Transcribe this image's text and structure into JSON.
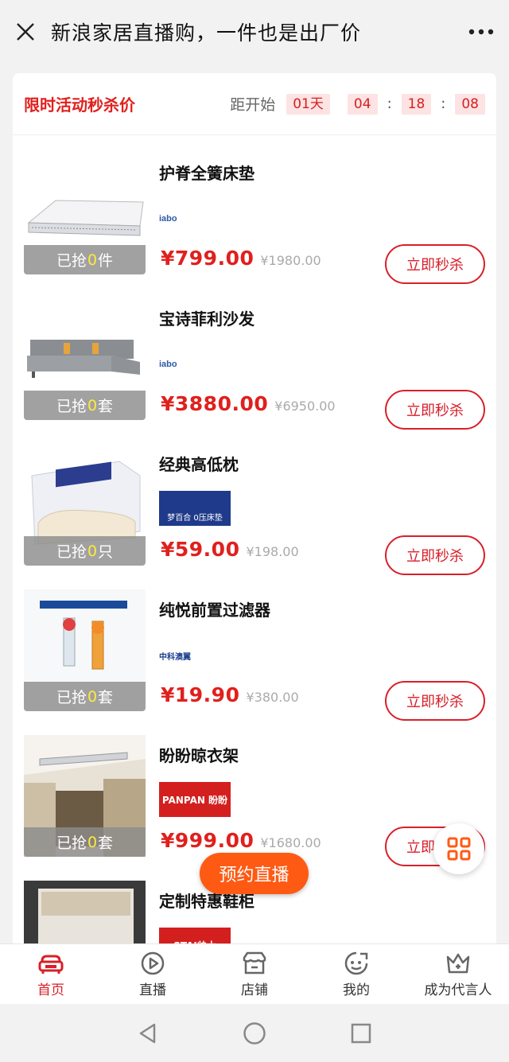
{
  "header": {
    "title": "新浪家居直播购，一件也是出厂价"
  },
  "flash": {
    "title": "限时活动秒杀价",
    "countdown_label": "距开始",
    "days": "01天",
    "hours": "04",
    "minutes": "18",
    "seconds": "08",
    "separator": ":"
  },
  "products": [
    {
      "name": "护脊全簧床垫",
      "price": "¥799.00",
      "original_price": "¥1980.00",
      "sold_prefix": "已抢",
      "sold_count": "0",
      "sold_unit": "件",
      "button": "立即秒杀",
      "brand": "iabo"
    },
    {
      "name": "宝诗菲利沙发",
      "price": "¥3880.00",
      "original_price": "¥6950.00",
      "sold_prefix": "已抢",
      "sold_count": "0",
      "sold_unit": "套",
      "button": "立即秒杀",
      "brand": "iabo"
    },
    {
      "name": "经典高低枕",
      "price": "¥59.00",
      "original_price": "¥198.00",
      "sold_prefix": "已抢",
      "sold_count": "0",
      "sold_unit": "只",
      "button": "立即秒杀",
      "brand": "梦百合 0压床垫"
    },
    {
      "name": "纯悦前置过滤器",
      "price": "¥19.90",
      "original_price": "¥380.00",
      "sold_prefix": "已抢",
      "sold_count": "0",
      "sold_unit": "套",
      "button": "立即秒杀",
      "brand": "中科澳翼"
    },
    {
      "name": "盼盼晾衣架",
      "price": "¥999.00",
      "original_price": "¥1680.00",
      "sold_prefix": "已抢",
      "sold_count": "0",
      "sold_unit": "套",
      "button": "立即秒杀",
      "brand": "PANPAN 盼盼"
    },
    {
      "name": "定制特惠鞋柜",
      "brand": "STAI帅太"
    }
  ],
  "floating": {
    "live_label": "预约直播"
  },
  "tabs": [
    {
      "label": "首页",
      "icon": "sofa-icon"
    },
    {
      "label": "直播",
      "icon": "play-icon"
    },
    {
      "label": "店铺",
      "icon": "store-icon"
    },
    {
      "label": "我的",
      "icon": "face-icon"
    },
    {
      "label": "成为代言人",
      "icon": "crown-icon"
    }
  ],
  "colors": {
    "accent": "#e0201d",
    "live": "#ff5a14",
    "countdown_bg": "#fde3e3"
  }
}
